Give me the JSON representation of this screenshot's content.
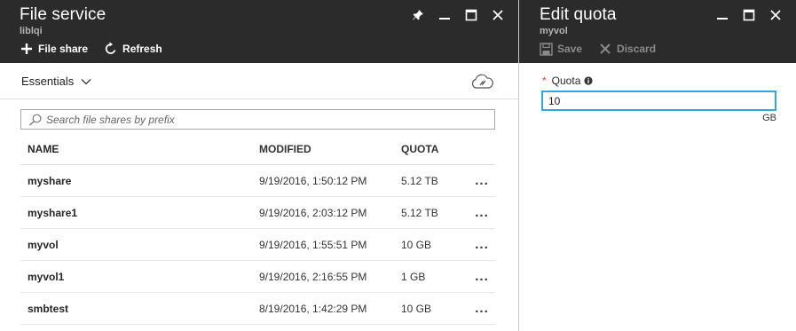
{
  "file_blade": {
    "title": "File service",
    "subtitle": "liblqi",
    "commands": [
      {
        "label": "File share",
        "icon": "plus-icon"
      },
      {
        "label": "Refresh",
        "icon": "refresh-icon"
      }
    ],
    "essentials_label": "Essentials",
    "search_placeholder": "Search file shares by prefix",
    "columns": {
      "name": "NAME",
      "modified": "MODIFIED",
      "quota": "QUOTA"
    },
    "rows": [
      {
        "name": "myshare",
        "modified": "9/19/2016, 1:50:12 PM",
        "quota": "5.12 TB",
        "more": "..."
      },
      {
        "name": "myshare1",
        "modified": "9/19/2016, 2:03:12 PM",
        "quota": "5.12 TB",
        "more": "..."
      },
      {
        "name": "myvol",
        "modified": "9/19/2016, 1:55:51 PM",
        "quota": "10 GB",
        "more": "..."
      },
      {
        "name": "myvol1",
        "modified": "9/19/2016, 2:16:55 PM",
        "quota": "1 GB",
        "more": "..."
      },
      {
        "name": "smbtest",
        "modified": "8/19/2016, 1:42:29 PM",
        "quota": "10 GB",
        "more": "..."
      }
    ]
  },
  "quota_blade": {
    "title": "Edit quota",
    "subtitle": "myvol",
    "commands": [
      {
        "label": "Save",
        "icon": "save-icon",
        "enabled": false
      },
      {
        "label": "Discard",
        "icon": "discard-icon",
        "enabled": false
      }
    ],
    "field_required_mark": "*",
    "field_label": "Quota",
    "field_value": "10",
    "unit": "GB"
  },
  "colors": {
    "header_bg": "#2b2b2b",
    "focus_border": "#2ea8de",
    "required": "#d93b3b",
    "subtitle": "#b3b3b3"
  }
}
